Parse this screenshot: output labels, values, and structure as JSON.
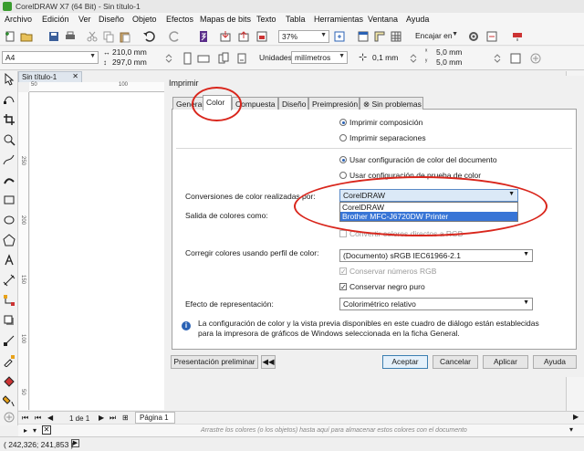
{
  "window": {
    "title": "CorelDRAW X7 (64 Bit) - Sin título-1"
  },
  "menu": [
    "Archivo",
    "Edición",
    "Ver",
    "Diseño",
    "Objeto",
    "Efectos",
    "Mapas de bits",
    "Texto",
    "Tabla",
    "Herramientas",
    "Ventana",
    "Ayuda"
  ],
  "toolbar": {
    "zoom": "37%",
    "snap": "Encajar en"
  },
  "propbar": {
    "page_size": "A4",
    "width": "210,0 mm",
    "height": "297,0 mm",
    "units_label": "Unidades:",
    "units": "milímetros",
    "nudge": "0,1 mm",
    "dup_x": "5,0 mm",
    "dup_y": "5,0 mm"
  },
  "document": {
    "tab": "Sin título-1",
    "ruler_h": [
      "50",
      "100"
    ],
    "ruler_v": [
      "250",
      "200",
      "150",
      "100",
      "50"
    ],
    "page_counter": "1 de 1",
    "page_tab": "Página 1",
    "color_hint": "Arrastre los colores (o los objetos) hasta aquí para almacenar estos colores con el documento",
    "coords": "( 242,326; 241,853 )"
  },
  "dialog": {
    "title": "Imprimir",
    "tabs": [
      "General",
      "Color",
      "Compuesta",
      "Diseño",
      "Preimpresión",
      "Sin problemas"
    ],
    "active_tab": "Color",
    "radio_composite": "Imprimir composición",
    "radio_separations": "Imprimir separaciones",
    "radio_doc_settings": "Usar configuración de color del documento",
    "radio_proof_settings": "Usar configuración de prueba de color",
    "conversions_label": "Conversiones de color realizadas por:",
    "conversions_value": "CorelDRAW",
    "conversions_options": [
      "CorelDRAW",
      "Brother MFC-J6720DW Printer"
    ],
    "output_label": "Salida de colores como:",
    "convert_rgb": "Convertir colores directos a RGB",
    "profile_label": "Corregir colores usando perfil de color:",
    "profile_value": "(Documento) sRGB IEC61966-2.1",
    "keep_rgb": "Conservar números RGB",
    "keep_black": "Conservar negro puro",
    "intent_label": "Efecto de representación:",
    "intent_value": "Colorimétrico relativo",
    "info": "La configuración de color y la vista previa disponibles en este cuadro de diálogo están establecidas para la impresora de gráficos de Windows seleccionada en la ficha General.",
    "btn_preview": "Presentación preliminar",
    "btn_accept": "Aceptar",
    "btn_cancel": "Cancelar",
    "btn_apply": "Aplicar",
    "btn_help": "Ayuda"
  }
}
